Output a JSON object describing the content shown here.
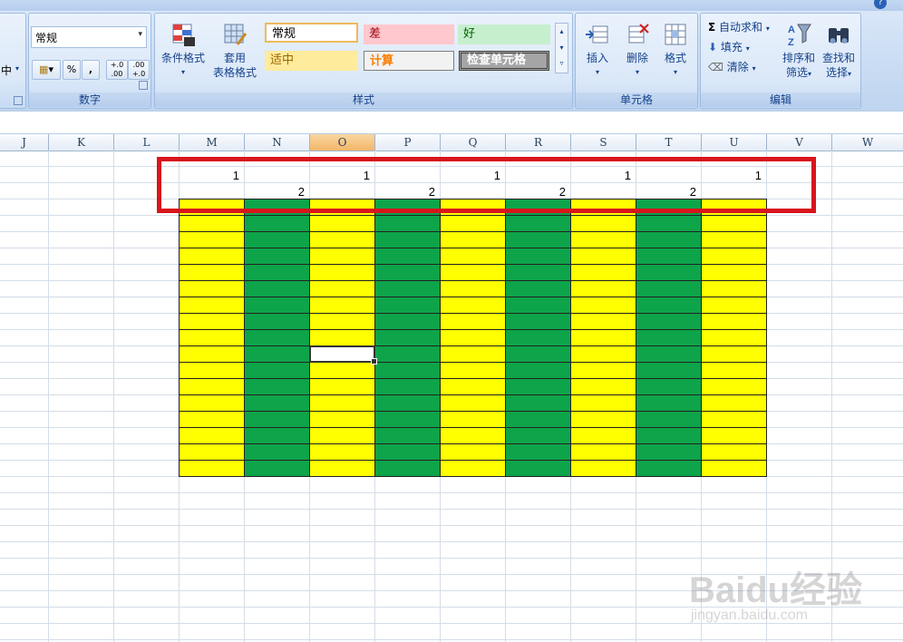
{
  "ribbon": {
    "align_partial": "中",
    "number_group": {
      "format_value": "常规",
      "percent": "%",
      "comma": ",",
      "inc_decimal": "+.0 .00",
      "dec_decimal": ".00 +.0",
      "label": "数字"
    },
    "style_group": {
      "conditional_format": "条件格式",
      "table_format_1": "套用",
      "table_format_2": "表格格式",
      "styles": [
        "常规",
        "差",
        "好",
        "适中",
        "计算",
        "检查单元格"
      ],
      "label": "样式"
    },
    "cells_group": {
      "insert": "插入",
      "delete": "删除",
      "format": "格式",
      "label": "单元格"
    },
    "edit_group": {
      "autosum": "自动求和",
      "fill": "填充",
      "clear": "清除",
      "sort_1": "排序和",
      "sort_2": "筛选",
      "find_1": "查找和",
      "find_2": "选择",
      "label": "编辑"
    }
  },
  "sheet": {
    "columns": [
      "J",
      "K",
      "L",
      "M",
      "N",
      "O",
      "P",
      "Q",
      "R",
      "S",
      "T",
      "U",
      "V",
      "W"
    ],
    "selected_column": "O",
    "row1_values": [
      "1",
      "1",
      "1",
      "1",
      "1"
    ],
    "row2_values": [
      "2",
      "2",
      "2",
      "2"
    ],
    "fill_colors": {
      "yellow": "#ffff00",
      "green": "#0ea44a"
    }
  },
  "watermark": {
    "brand": "Baidu经验",
    "url": "jingyan.baidu.com"
  }
}
